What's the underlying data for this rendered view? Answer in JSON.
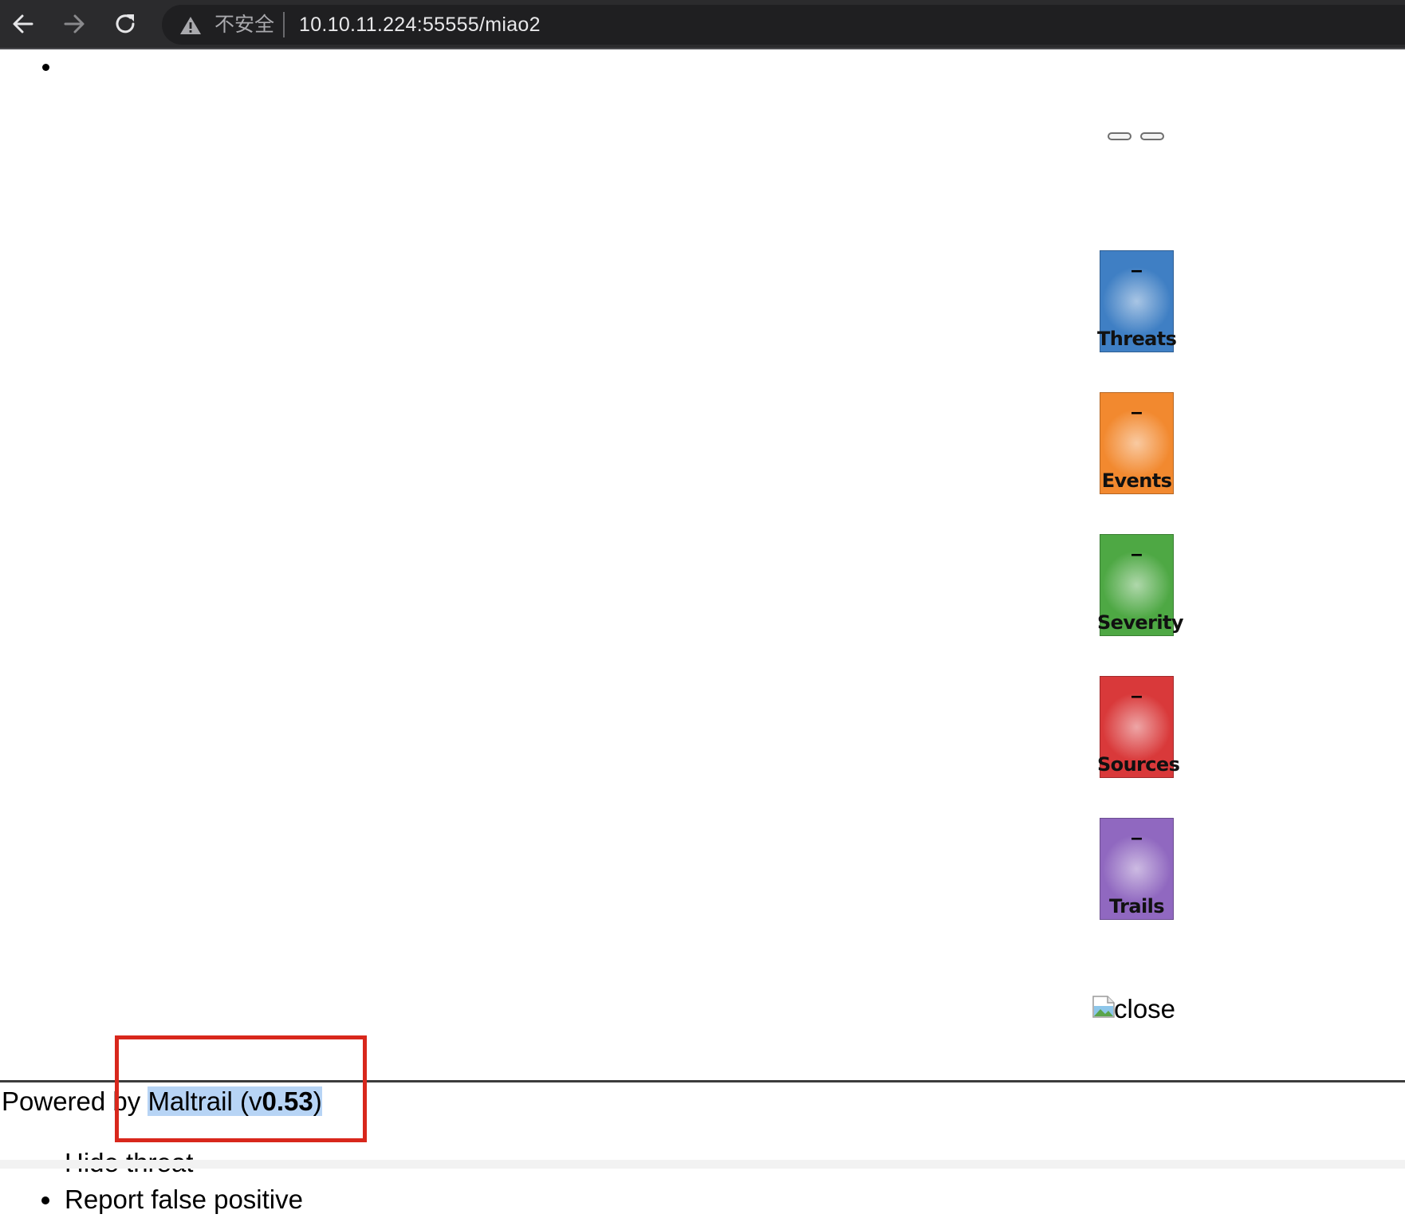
{
  "browser": {
    "insecure_label": "不安全",
    "url": "10.10.11.224:55555/miao2"
  },
  "stats": [
    {
      "label": "Threats",
      "value": "–",
      "color": "#3f7fc4"
    },
    {
      "label": "Events",
      "value": "–",
      "color": "#f2892f"
    },
    {
      "label": "Severity",
      "value": "–",
      "color": "#4ea844"
    },
    {
      "label": "Sources",
      "value": "–",
      "color": "#d9393a"
    },
    {
      "label": "Trails",
      "value": "–",
      "color": "#9068c0"
    }
  ],
  "close_image_alt": "close",
  "footer": {
    "prefix": "Powered by ",
    "product": "Maltrail",
    "version_open": " (v",
    "version": "0.53",
    "version_close": ")"
  },
  "context_menu": [
    "Hide threat",
    "Report false positive"
  ]
}
